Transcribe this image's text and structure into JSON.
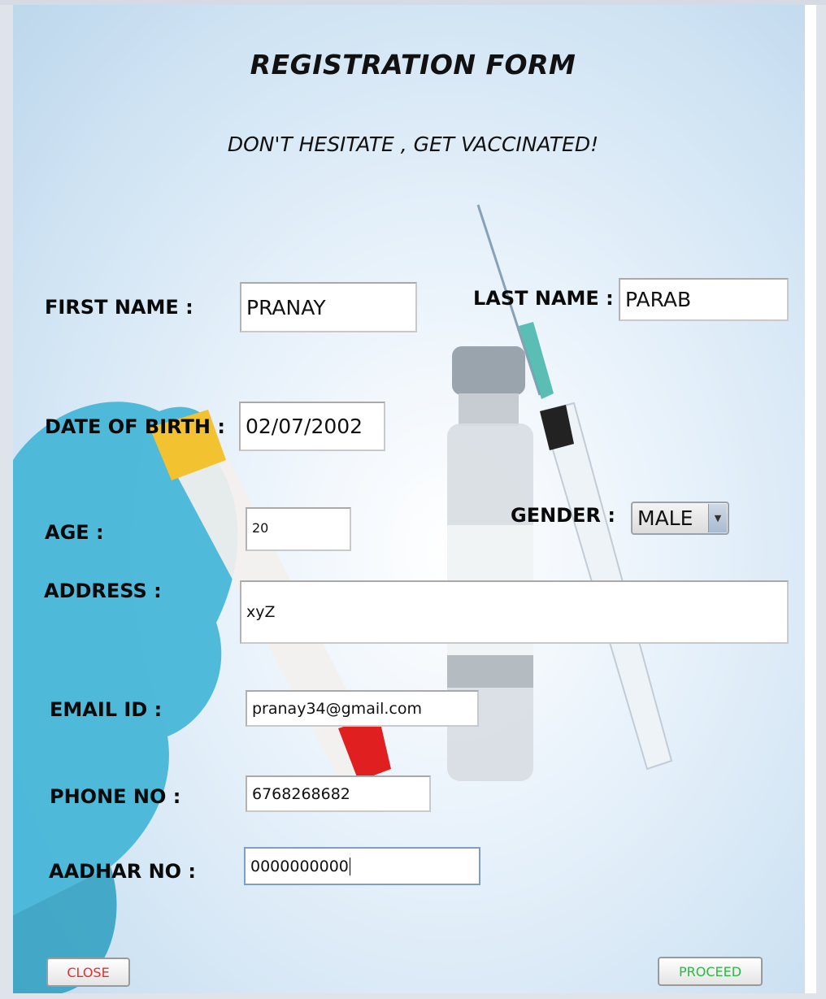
{
  "form": {
    "title": "REGISTRATION FORM",
    "subtitle": "DON'T HESITATE , GET VACCINATED!"
  },
  "fields": {
    "first_name": {
      "label": "FIRST NAME :",
      "value": "PRANAY"
    },
    "last_name": {
      "label": "LAST NAME :",
      "value": "PARAB"
    },
    "dob": {
      "label": "DATE OF BIRTH :",
      "value": "02/07/2002"
    },
    "age": {
      "label": "AGE :",
      "value": "20"
    },
    "gender": {
      "label": "GENDER :",
      "selected": "MALE"
    },
    "address": {
      "label": "ADDRESS :",
      "value": "xyZ"
    },
    "email": {
      "label": "EMAIL ID :",
      "value": "pranay34@gmail.com"
    },
    "phone": {
      "label": "PHONE NO :",
      "value": "6768268682"
    },
    "aadhar": {
      "label": "AADHAR NO :",
      "value": "0000000000"
    }
  },
  "buttons": {
    "close_label": "CLOSE",
    "proceed_label": "PROCEED"
  },
  "colors": {
    "close_text": "#e03030",
    "proceed_text": "#2bb843",
    "background": "#cfe3f3"
  },
  "icons": {
    "gender_dropdown": "chevron-down-icon",
    "background": "vaccine-illustration"
  }
}
